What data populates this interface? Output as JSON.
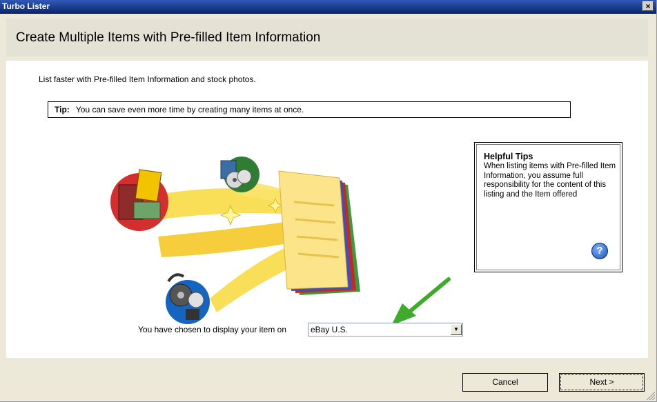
{
  "window": {
    "title": "Turbo Lister",
    "close_glyph": "×"
  },
  "header": {
    "heading": "Create Multiple Items with Pre-filled Item Information"
  },
  "content": {
    "intro": "List faster with Pre-filled Item Information and stock photos.",
    "tip": {
      "label": "Tip:",
      "text": "You can save even more time by creating many items at once."
    },
    "helpful_tips": {
      "title": "Helpful Tips",
      "body": "When listing items with Pre-filled Item Information, you assume full responsibility for the content of this listing and the Item offered",
      "help_glyph": "?"
    },
    "site": {
      "label": "You have chosen to display your item on",
      "selected": "eBay U.S."
    }
  },
  "buttons": {
    "cancel": "Cancel",
    "next": "Next >"
  },
  "colors": {
    "titlebar": "#0a246a",
    "window_bg": "#ece9d8",
    "arrow": "#3faa2c"
  }
}
